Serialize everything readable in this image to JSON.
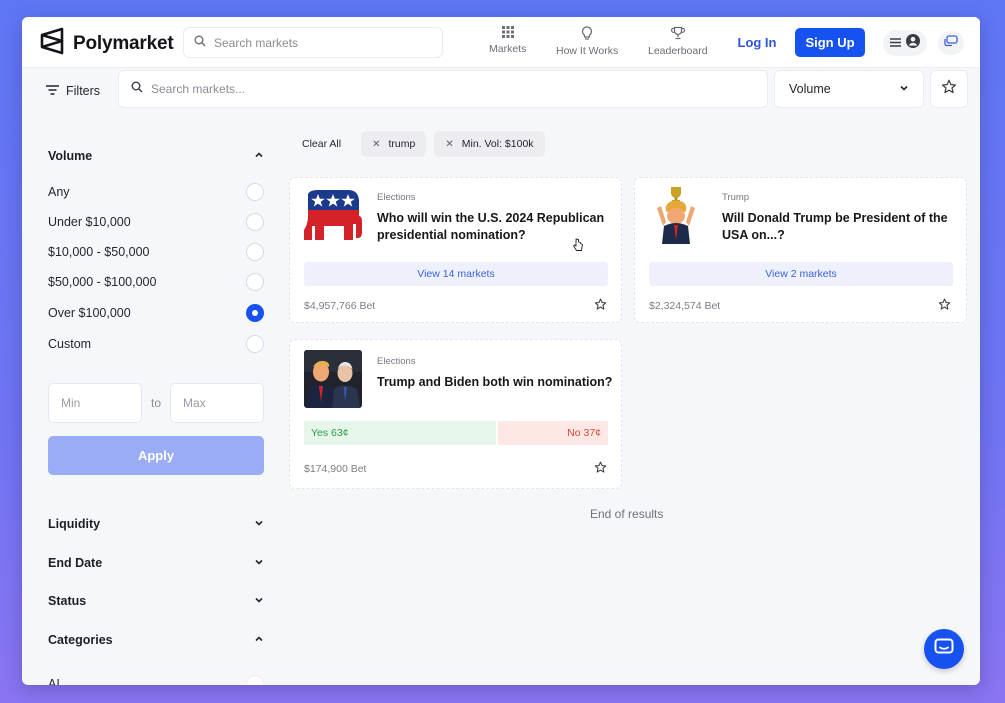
{
  "header": {
    "brand": "Polymarket",
    "search_placeholder": "Search markets",
    "nav": [
      {
        "label": "Markets",
        "icon": "grid-icon"
      },
      {
        "label": "How It Works",
        "icon": "lightbulb-icon"
      },
      {
        "label": "Leaderboard",
        "icon": "trophy-icon"
      }
    ],
    "login_label": "Log In",
    "signup_label": "Sign Up"
  },
  "filterbar": {
    "filters_label": "Filters",
    "search_placeholder": "Search markets...",
    "sort_value": "Volume"
  },
  "sidebar": {
    "volume_heading": "Volume",
    "volume_options": [
      "Any",
      "Under $10,000",
      "$10,000 - $50,000",
      "$50,000 - $100,000",
      "Over $100,000",
      "Custom"
    ],
    "volume_selected": "Over $100,000",
    "min_placeholder": "Min",
    "range_to": "to",
    "max_placeholder": "Max",
    "apply_label": "Apply",
    "sections": [
      "Liquidity",
      "End Date",
      "Status",
      "Categories"
    ],
    "category_first": "AI"
  },
  "active_filters": {
    "clear_label": "Clear All",
    "chips": [
      "trump",
      "Min. Vol: $100k"
    ]
  },
  "markets": [
    {
      "category": "Elections",
      "title_line1": "Who will win the U.S. 2024 Republican",
      "title_line2": "presidential nomination?",
      "action": "View 14 markets",
      "volume": "$4,957,766 Bet",
      "image": "republican-elephant-logo"
    },
    {
      "category": "Trump",
      "title_line1": "Will Donald Trump be President of the",
      "title_line2": "USA on...?",
      "action": "View 2 markets",
      "volume": "$2,324,574 Bet",
      "image": "trump-trophy-cartoon"
    },
    {
      "category": "Elections",
      "title_line1": "Trump and Biden both win nomination?",
      "yes_label": "Yes 63¢",
      "no_label": "No 37¢",
      "yes_share": 0.63,
      "volume": "$174,900 Bet",
      "image": "trump-biden-photo"
    }
  ],
  "end_of_results": "End of results",
  "colors": {
    "accent": "#1652f0",
    "yes": "#27a046",
    "no": "#e0452f",
    "background_gradient": "#6f74f2"
  }
}
